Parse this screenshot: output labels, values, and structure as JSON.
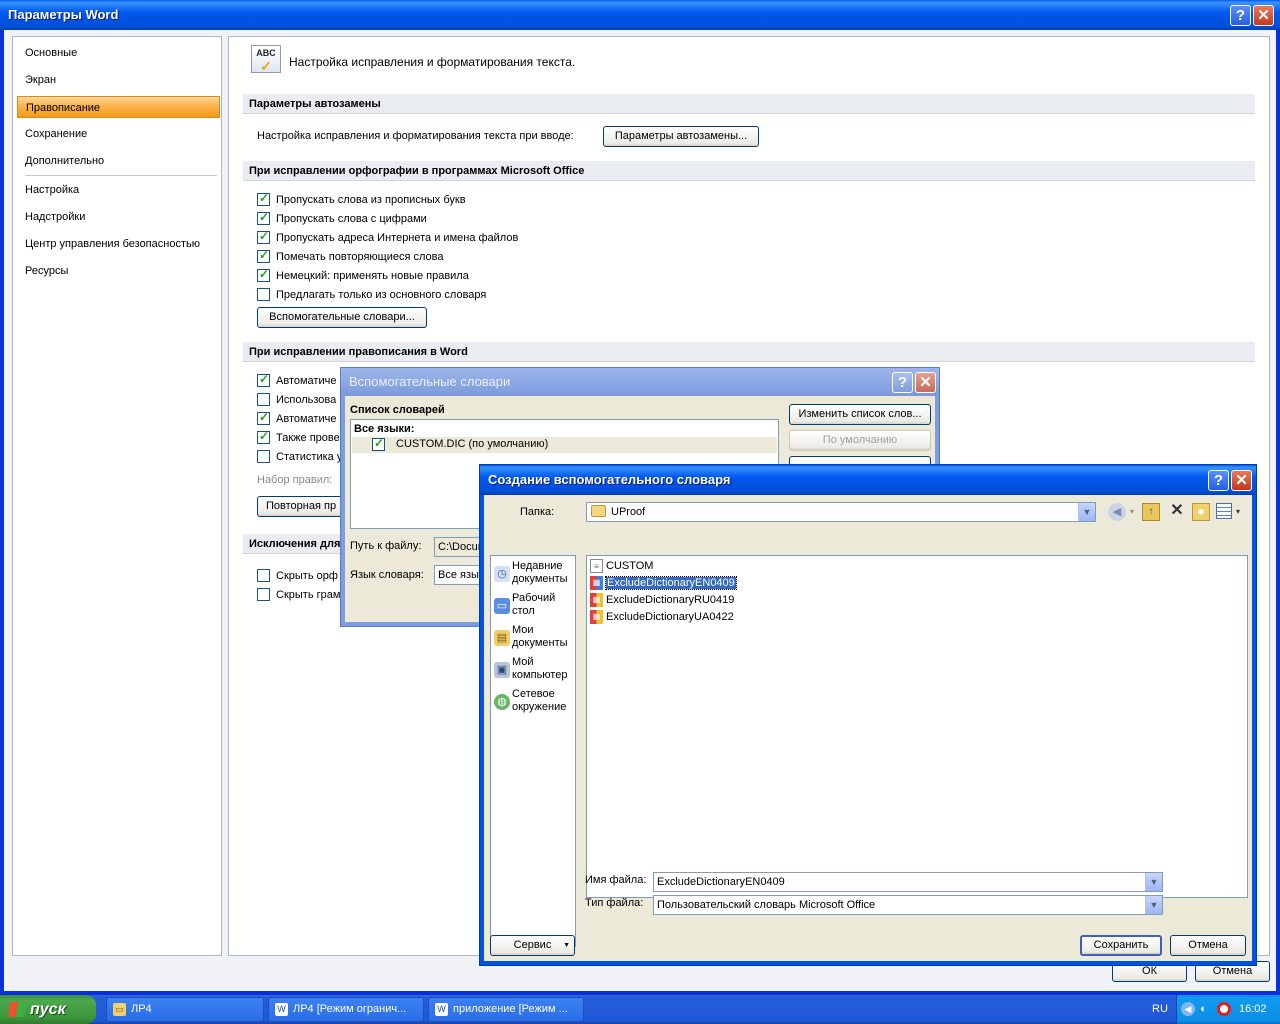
{
  "main_window": {
    "title": "Параметры Word",
    "help_glyph": "?",
    "close_glyph": "✕"
  },
  "nav": {
    "items": [
      {
        "label": "Основные"
      },
      {
        "label": "Экран"
      },
      {
        "label": "Правописание"
      },
      {
        "label": "Сохранение"
      },
      {
        "label": "Дополнительно"
      },
      {
        "label": "Настройка"
      },
      {
        "label": "Надстройки"
      },
      {
        "label": "Центр управления безопасностью"
      },
      {
        "label": "Ресурсы"
      }
    ]
  },
  "content": {
    "header_icon_text": "ABC",
    "header": "Настройка исправления и форматирования текста.",
    "autocorrect": {
      "section": "Параметры автозамены",
      "label": "Настройка исправления и форматирования текста при вводе:",
      "button": "Параметры автозамены..."
    },
    "office_spelling": {
      "section": "При исправлении орфографии в программах Microsoft Office",
      "options": [
        {
          "label": "Пропускать слова из прописных букв",
          "checked": true
        },
        {
          "label": "Пропускать слова с цифрами",
          "checked": true
        },
        {
          "label": "Пропускать адреса Интернета и имена файлов",
          "checked": true
        },
        {
          "label": "Помечать повторяющиеся слова",
          "checked": true
        },
        {
          "label": "Немецкий: применять новые правила",
          "checked": true
        },
        {
          "label": "Предлагать только из основного словаря",
          "checked": false
        }
      ],
      "button": "Вспомогательные словари..."
    },
    "word_spelling": {
      "section": "При исправлении правописания в Word",
      "options": [
        {
          "label": "Автоматиче",
          "checked": true
        },
        {
          "label": "Использова",
          "checked": false
        },
        {
          "label": "Автоматиче",
          "checked": true
        },
        {
          "label": "Также прове",
          "checked": true
        },
        {
          "label": "Статистика у",
          "checked": false
        }
      ],
      "rules_label": "Набор правил:",
      "recheck_button": "Повторная пр"
    },
    "exceptions": {
      "section": "Исключения для",
      "options": [
        {
          "label": "Скрыть орф",
          "checked": false
        },
        {
          "label": "Скрыть грам",
          "checked": false
        }
      ]
    },
    "ok_button": "ОК",
    "cancel_button": "Отмена"
  },
  "dialog_custom_dicts": {
    "title": "Вспомогательные словари",
    "list_label": "Список словарей",
    "group_label": "Все языки:",
    "item": {
      "label": "CUSTOM.DIC (по умолчанию)",
      "checked": true
    },
    "edit_button": "Изменить список слов...",
    "default_button": "По умолчанию",
    "path_label": "Путь к файлу:",
    "path_value": "C:\\Docum",
    "lang_label": "Язык словаря:",
    "lang_value": "Все язык"
  },
  "dialog_create_dict": {
    "title": "Создание вспомогательного словаря",
    "folder_label": "Папка:",
    "folder_value": "UProof",
    "places": [
      {
        "label": "Недавние документы",
        "icon": "recent-documents-icon"
      },
      {
        "label": "Рабочий стол",
        "icon": "desktop-icon"
      },
      {
        "label": "Мои документы",
        "icon": "my-documents-icon"
      },
      {
        "label": "Мой компьютер",
        "icon": "my-computer-icon"
      },
      {
        "label": "Сетевое окружение",
        "icon": "network-icon"
      }
    ],
    "files": [
      {
        "name": "CUSTOM",
        "selected": false
      },
      {
        "name": "ExcludeDictionaryEN0409",
        "selected": true
      },
      {
        "name": "ExcludeDictionaryRU0419",
        "selected": false
      },
      {
        "name": "ExcludeDictionaryUA0422",
        "selected": false
      }
    ],
    "filename_label": "Имя файла:",
    "filename_value": "ExcludeDictionaryEN0409",
    "filetype_label": "Тип файла:",
    "filetype_value": "Пользовательский словарь Microsoft Office",
    "tools_button": "Сервис",
    "save_button": "Сохранить",
    "cancel_button": "Отмена"
  },
  "taskbar": {
    "start_label": "пуск",
    "tasks": [
      {
        "label": "ЛР4"
      },
      {
        "label": "ЛР4 [Режим огранич..."
      },
      {
        "label": "приложение [Режим ..."
      }
    ],
    "lang": "RU",
    "clock": "16:02"
  }
}
